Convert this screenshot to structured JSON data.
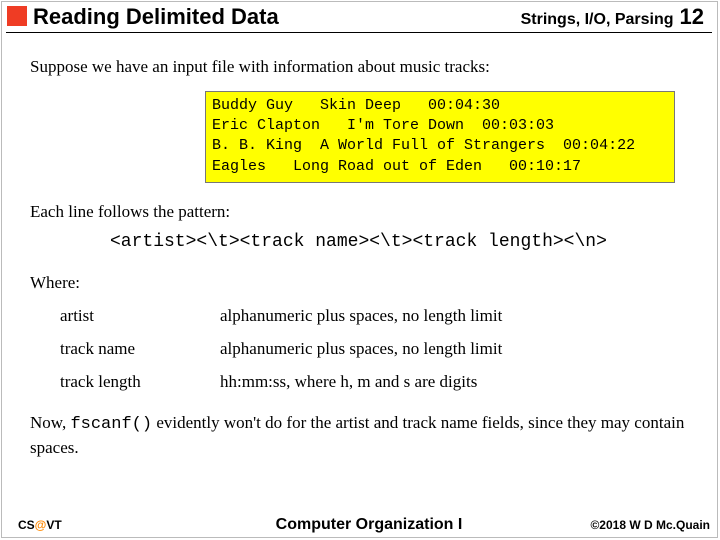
{
  "header": {
    "title": "Reading Delimited Data",
    "subtopic": "Strings, I/O, Parsing",
    "slide_no": "12"
  },
  "intro": "Suppose we have an input file with information about music tracks:",
  "code": {
    "l1": "Buddy Guy   Skin Deep   00:04:30",
    "l2": "Eric Clapton   I'm Tore Down  00:03:03",
    "l3": "B. B. King  A World Full of Strangers  00:04:22",
    "l4": "Eagles   Long Road out of Eden   00:10:17"
  },
  "pattern_intro": "Each line follows the pattern:",
  "pattern": "<artist><\\t><track name><\\t><track length><\\n>",
  "where_label": "Where:",
  "defs": {
    "artist_term": "artist",
    "artist_desc": "alphanumeric plus spaces, no length limit",
    "name_term": "track name",
    "name_desc": "alphanumeric plus spaces, no length limit",
    "len_term": "track length",
    "len_desc": "hh:mm:ss, where h, m and s are digits"
  },
  "outro_a": "Now, ",
  "outro_code": "fscanf()",
  "outro_b": " evidently won't do for the artist and track name fields, since they may contain spaces.",
  "foot": {
    "left_a": "CS",
    "left_at": "@",
    "left_b": "VT",
    "center": "Computer Organization I",
    "right": "©2018 W D Mc.Quain"
  }
}
